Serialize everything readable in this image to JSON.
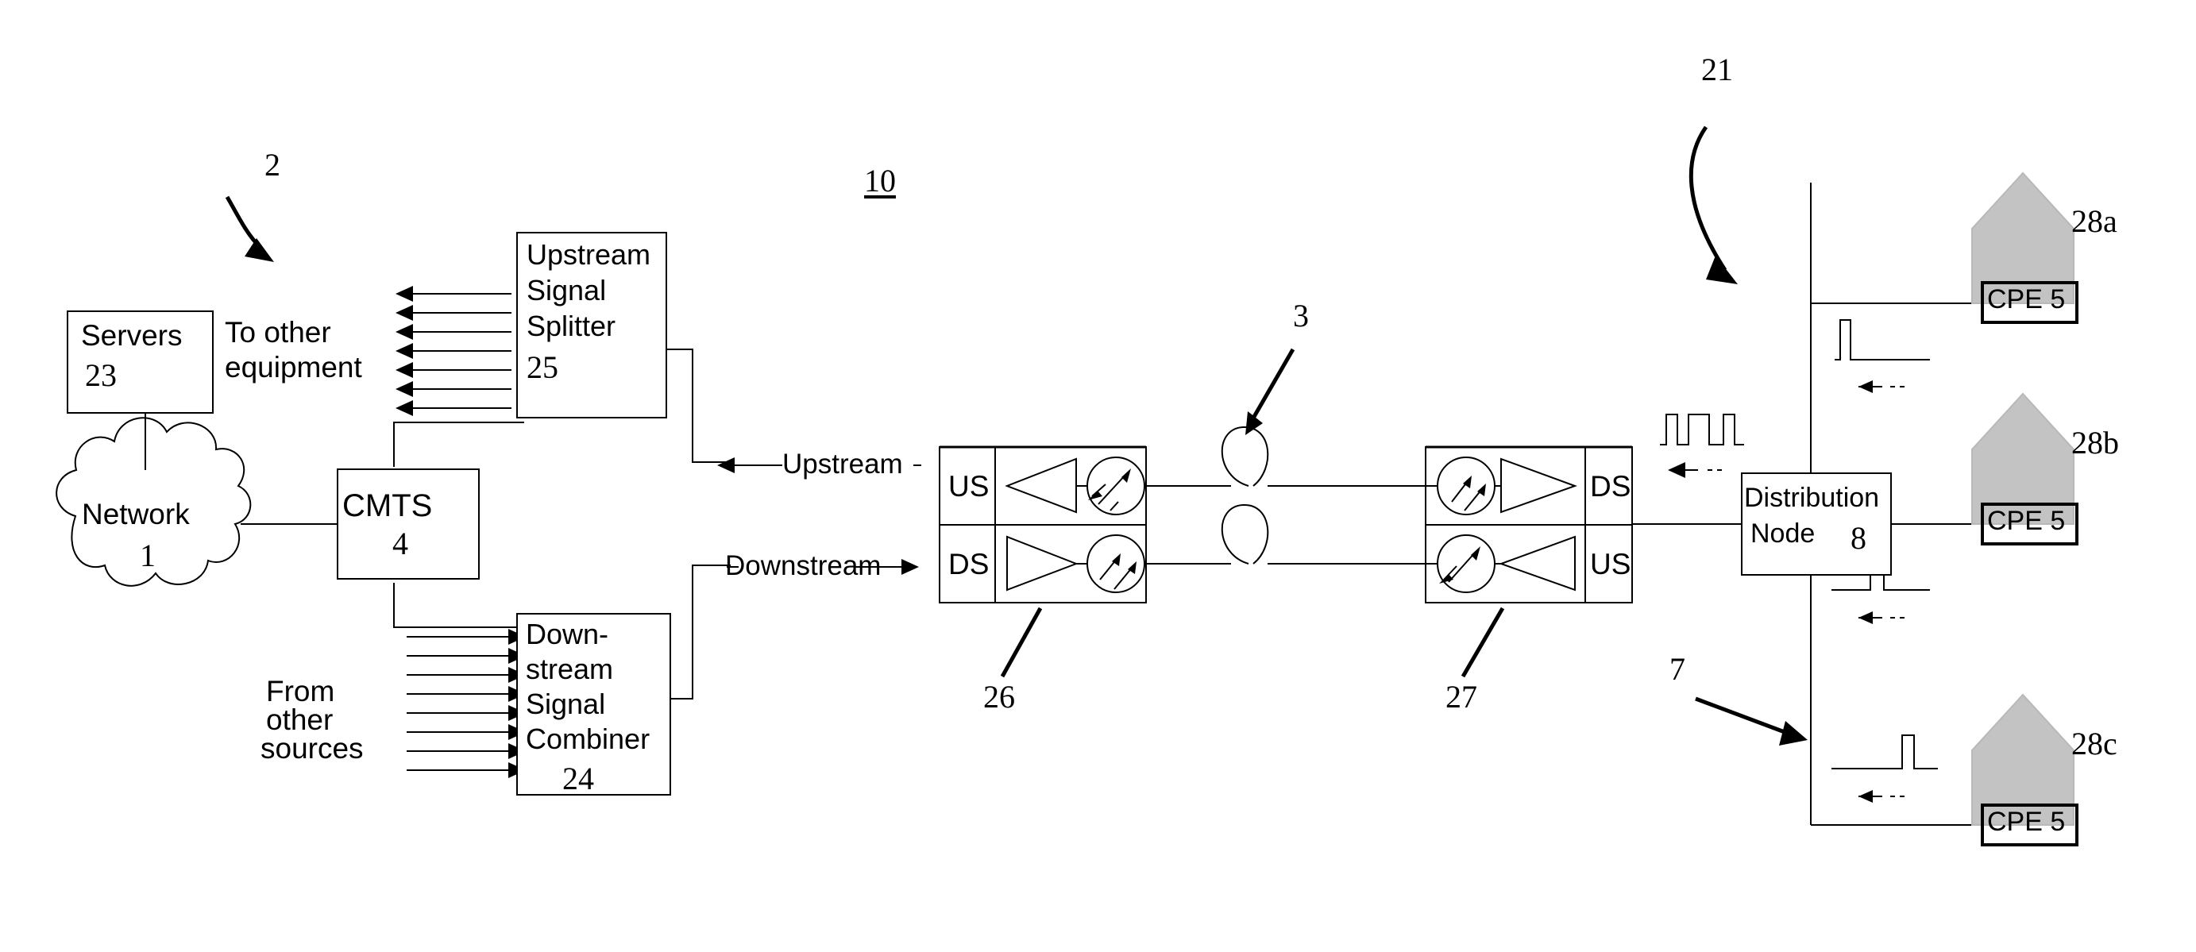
{
  "figure": {
    "id_label": "10",
    "type": "patent-network-diagram",
    "title": "Cable access network with upstream/downstream optical link"
  },
  "reference_numerals": {
    "system": "2",
    "network": "1",
    "cmts": "4",
    "servers": "23",
    "upstream_splitter": "25",
    "downstream_combiner": "24",
    "headend": "10",
    "fiber": "3",
    "transceiver_near": "26",
    "transceiver_far": "27",
    "distribution_node": "8",
    "coax_upstream_plant": "21",
    "coax_downstream_plant": "7",
    "cpe_a": "28a",
    "cpe_b": "28b",
    "cpe_c": "28c",
    "cpe_device": "5"
  },
  "blocks": {
    "servers": {
      "name": "Servers",
      "num": "23"
    },
    "network": {
      "name": "Network",
      "num": "1"
    },
    "cmts": {
      "name": "CMTS",
      "num": "4"
    },
    "upstream_splitter": {
      "line1": "Upstream",
      "line2": "Signal",
      "line3": "Splitter",
      "num": "25"
    },
    "downstream_combiner": {
      "line1": "Down-",
      "line2": "stream",
      "line3": "Signal",
      "line4": "Combiner",
      "num": "24"
    },
    "distribution_node": {
      "line1": "Distribution",
      "line2": "Node",
      "num": "8"
    }
  },
  "annotations": {
    "to_other_equipment": "To other\nequipment",
    "to_other_equipment_l1": "To other",
    "to_other_equipment_l2": "equipment",
    "from_other_sources_l1": "From",
    "from_other_sources_l2": "other",
    "from_other_sources_l3": "sources",
    "upstream_arrow_label": "Upstream",
    "downstream_arrow_label": "Downstream"
  },
  "transceivers": {
    "near": {
      "num": "26",
      "top_port": "US",
      "bottom_port": "DS"
    },
    "far": {
      "num": "27",
      "top_port": "DS",
      "bottom_port": "US"
    }
  },
  "fiber": {
    "num": "3",
    "loop_count": 2
  },
  "cpes": [
    {
      "id": "28a",
      "label": "CPE 5",
      "device_name": "CPE",
      "device_num": "5",
      "burst_position": "left"
    },
    {
      "id": "28b",
      "label": "CPE 5",
      "device_name": "CPE",
      "device_num": "5",
      "burst_position": "center"
    },
    {
      "id": "28c",
      "label": "CPE 5",
      "device_name": "CPE",
      "device_num": "5",
      "burst_position": "right"
    }
  ],
  "waveform": {
    "trunk_pulses": 3,
    "branch_pulses": 1
  },
  "colors": {
    "line": "#000000",
    "house_fill": "#c8c8c8",
    "background": "#ffffff"
  },
  "icons": {
    "amplifier": "triangle-amplifier-icon",
    "optical_converter": "circle-transducer-icon",
    "fiber_loop": "fiber-slack-loop-icon",
    "house": "house-icon",
    "pulse": "pulse-waveform-icon",
    "flow_arrow": "flow-arrow-icon",
    "leader_arrow": "leader-arrow-icon"
  }
}
